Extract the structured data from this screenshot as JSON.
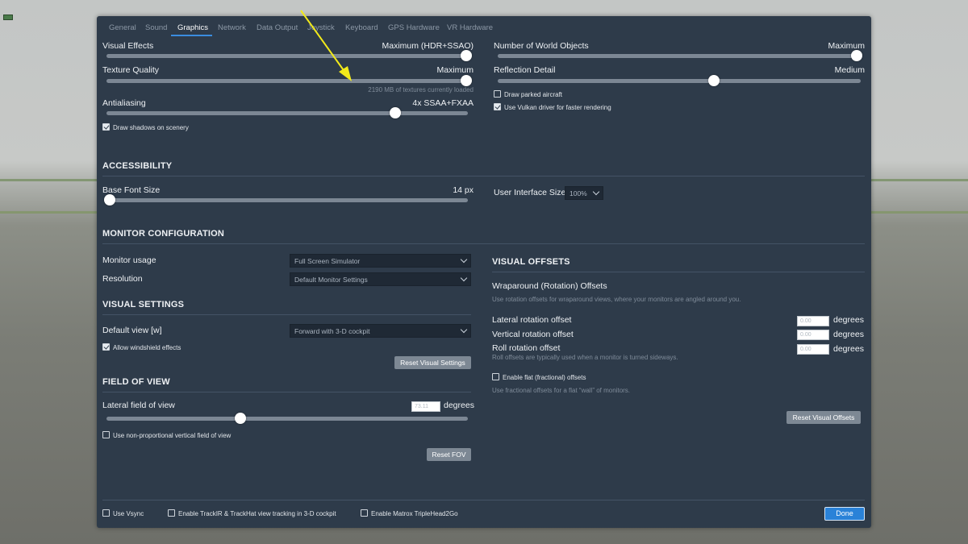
{
  "tabs": [
    "General",
    "Sound",
    "Graphics",
    "Network",
    "Data Output",
    "Joystick",
    "Keyboard",
    "GPS Hardware",
    "VR Hardware"
  ],
  "active_tab": "Graphics",
  "graphics": {
    "visual_effects": {
      "label": "Visual Effects",
      "value": "Maximum (HDR+SSAO)",
      "level": 1.0
    },
    "texture_quality": {
      "label": "Texture Quality",
      "value": "Maximum",
      "level": 1.0,
      "hint": "2190 MB of textures currently loaded"
    },
    "antialiasing": {
      "label": "Antialiasing",
      "value": "4x SSAA+FXAA",
      "level": 0.8
    },
    "draw_shadows": {
      "label": "Draw shadows on scenery",
      "checked": true
    },
    "world_objects": {
      "label": "Number of World Objects",
      "value": "Maximum",
      "level": 1.0
    },
    "reflection_detail": {
      "label": "Reflection Detail",
      "value": "Medium",
      "level": 0.6
    },
    "draw_parked_aircraft": {
      "label": "Draw parked aircraft",
      "checked": false
    },
    "vulkan": {
      "label": "Use Vulkan driver for faster rendering",
      "checked": true
    }
  },
  "accessibility": {
    "header": "ACCESSIBILITY",
    "base_font": {
      "label": "Base Font Size",
      "value": "14 px",
      "level": 0.0
    },
    "ui_size": {
      "label": "User Interface Size",
      "value": "100%"
    }
  },
  "monitor": {
    "header": "MONITOR CONFIGURATION",
    "usage": {
      "label": "Monitor usage",
      "value": "Full Screen Simulator"
    },
    "resolution": {
      "label": "Resolution",
      "value": "Default Monitor Settings"
    }
  },
  "visual_settings": {
    "header": "VISUAL SETTINGS",
    "default_view": {
      "label": "Default view [w]",
      "value": "Forward with 3-D cockpit"
    },
    "windshield": {
      "label": "Allow windshield effects",
      "checked": true
    },
    "reset": "Reset Visual Settings"
  },
  "fov": {
    "header": "FIELD OF VIEW",
    "lateral": {
      "label": "Lateral field of view",
      "value": "73.11",
      "unit": "degrees",
      "level": 0.37
    },
    "non_prop": {
      "label": "Use non-proportional vertical field of view",
      "checked": false
    },
    "reset": "Reset FOV"
  },
  "offsets": {
    "header": "VISUAL OFFSETS",
    "wrap_title": "Wraparound (Rotation) Offsets",
    "wrap_hint": "Use rotation offsets for wraparound views, where your monitors are angled around you.",
    "lateral": {
      "label": "Lateral rotation offset",
      "value": "0.00",
      "unit": "degrees"
    },
    "vertical": {
      "label": "Vertical rotation offset",
      "value": "0.00",
      "unit": "degrees"
    },
    "roll": {
      "label": "Roll rotation offset",
      "value": "0.00",
      "unit": "degrees",
      "hint": "Roll offsets are typically used when a monitor is turned sideways."
    },
    "flat": {
      "label": "Enable flat (fractional) offsets",
      "checked": false,
      "hint": "Use fractional offsets for a flat “wall” of monitors."
    },
    "reset": "Reset Visual Offsets"
  },
  "footer": {
    "vsync": {
      "label": "Use Vsync",
      "checked": false
    },
    "trackir": {
      "label": "Enable TrackIR & TrackHat view tracking in 3-D cockpit",
      "checked": false
    },
    "matrox": {
      "label": "Enable Matrox TripleHead2Go",
      "checked": false
    },
    "done": "Done"
  },
  "colors": {
    "panel": "#2e3b4a",
    "accent": "#2a82d8",
    "annotation_arrow": "#f2ea1a"
  }
}
